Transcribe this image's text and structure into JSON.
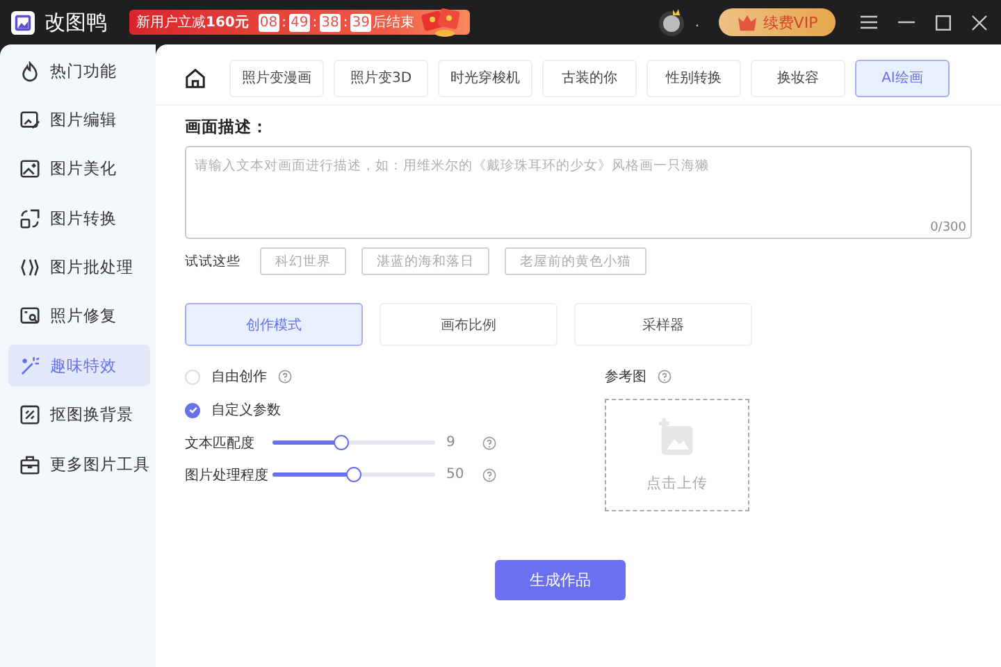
{
  "app": {
    "name": "改图鸭"
  },
  "promo": {
    "text": "新用户立减",
    "amount": "160元",
    "countdown": [
      {
        "kind": "digit",
        "text": "08"
      },
      {
        "kind": "sep",
        "text": ":"
      },
      {
        "kind": "digit",
        "text": "49"
      },
      {
        "kind": "sep",
        "text": ":"
      },
      {
        "kind": "digit",
        "text": "38"
      },
      {
        "kind": "sep",
        "text": ":"
      },
      {
        "kind": "digit",
        "text": "39"
      }
    ],
    "suffix": "后结束"
  },
  "user": {
    "name": "."
  },
  "vip_button": "续费VIP",
  "sidebar": {
    "items": [
      {
        "label": "热门功能",
        "selected": false
      },
      {
        "label": "图片编辑",
        "selected": false
      },
      {
        "label": "图片美化",
        "selected": false
      },
      {
        "label": "图片转换",
        "selected": false
      },
      {
        "label": "图片批处理",
        "selected": false
      },
      {
        "label": "照片修复",
        "selected": false
      },
      {
        "label": "趣味特效",
        "selected": true
      },
      {
        "label": "抠图换背景",
        "selected": false
      },
      {
        "label": "更多图片工具",
        "selected": false
      }
    ]
  },
  "tabs": [
    {
      "label": "照片变漫画",
      "selected": false
    },
    {
      "label": "照片变3D",
      "selected": false
    },
    {
      "label": "时光穿梭机",
      "selected": false
    },
    {
      "label": "古装的你",
      "selected": false
    },
    {
      "label": "性别转换",
      "selected": false
    },
    {
      "label": "换妆容",
      "selected": false
    },
    {
      "label": "AI绘画",
      "selected": true
    }
  ],
  "description": {
    "heading": "画面描述：",
    "placeholder": "请输入文本对画面进行描述，如：用维米尔的《戴珍珠耳环的少女》风格画一只海獭",
    "counter": "0/300"
  },
  "suggestions": {
    "label": "试试这些",
    "items": [
      "科幻世界",
      "湛蓝的海和落日",
      "老屋前的黄色小猫"
    ]
  },
  "mode_tabs": [
    {
      "label": "创作模式",
      "selected": true
    },
    {
      "label": "画布比例",
      "selected": false
    },
    {
      "label": "采样器",
      "selected": false
    }
  ],
  "options": [
    {
      "label": "自由创作",
      "selected": false,
      "help": true
    },
    {
      "label": "自定义参数",
      "selected": true,
      "help": false
    }
  ],
  "sliders": [
    {
      "label": "文本匹配度",
      "level": 0.42,
      "reading": "9"
    },
    {
      "label": "图片处理程度",
      "level": 0.5,
      "reading": "50"
    }
  ],
  "reference": {
    "label": "参考图",
    "upload": "点击上传"
  },
  "generate_button": "生成作品"
}
